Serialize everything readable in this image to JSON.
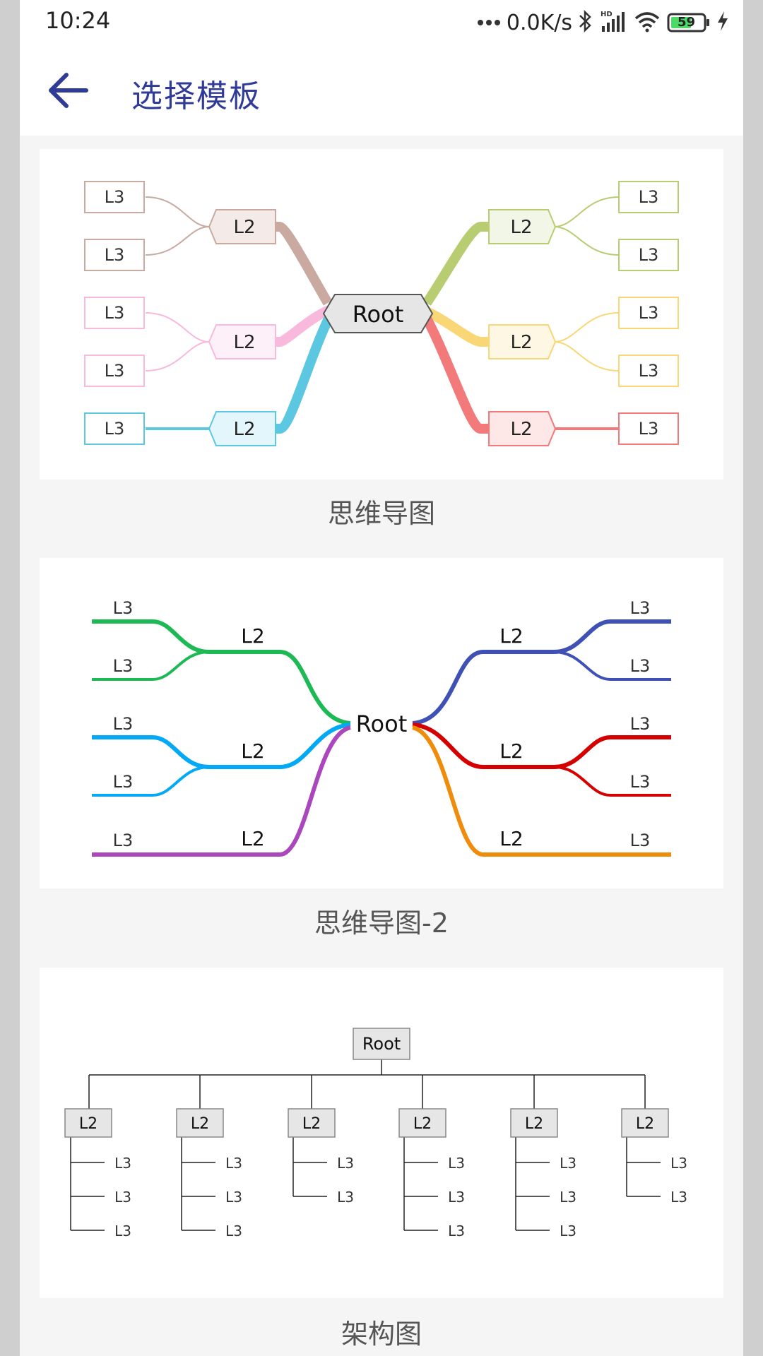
{
  "status": {
    "time": "10:24",
    "net_speed": "0.0K/s",
    "battery": "59",
    "icons": [
      "bluetooth-icon",
      "hd-signal-icon",
      "wifi-icon",
      "battery-icon",
      "charging-icon"
    ]
  },
  "header": {
    "title": "选择模板",
    "back_icon": "arrow-left-icon",
    "accent_color": "#2f3b97"
  },
  "templates": [
    {
      "label": "思维导图",
      "root": "Root",
      "l2": "L2",
      "l3": "L3",
      "branch_colors": [
        "#c9a9a0",
        "#f8b9dd",
        "#5bc7e0",
        "#b8cc72",
        "#f9d776",
        "#f27a7a"
      ]
    },
    {
      "label": "思维导图-2",
      "root": "Root",
      "l2": "L2",
      "l3": "L3",
      "branch_colors": [
        "#1db954",
        "#03a9f4",
        "#ab47bc",
        "#3f51b5",
        "#d50000",
        "#ef8c0b"
      ]
    },
    {
      "label": "架构图",
      "root": "Root",
      "l2": "L2",
      "l3": "L3"
    }
  ]
}
